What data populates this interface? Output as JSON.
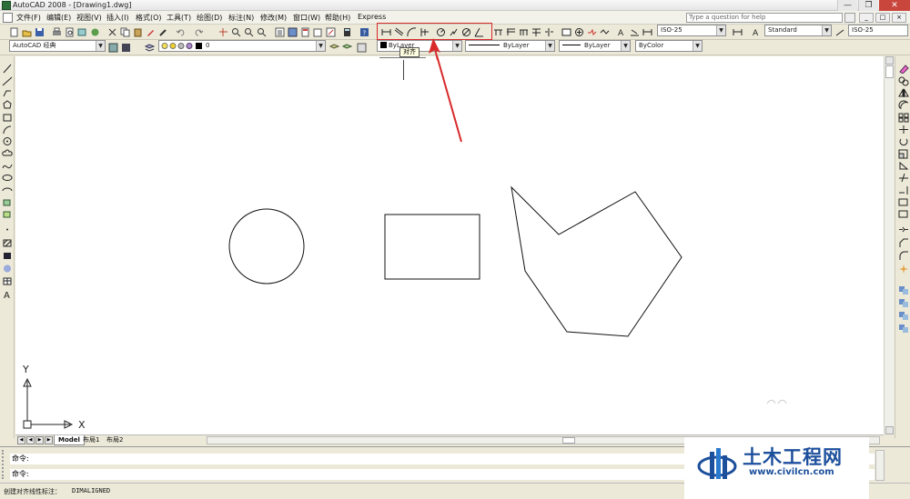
{
  "window": {
    "title": "AutoCAD 2008 - [Drawing1.dwg]",
    "minimize_glyph": "—",
    "restore_glyph": "❐",
    "close_glyph": "✕"
  },
  "menu": {
    "items": [
      "文件(F)",
      "编辑(E)",
      "视图(V)",
      "插入(I)",
      "格式(O)",
      "工具(T)",
      "绘图(D)",
      "标注(N)",
      "修改(M)",
      "窗口(W)",
      "帮助(H)",
      "Express"
    ],
    "help_search_placeholder": "Type a question for help",
    "mdi_min": "_",
    "mdi_restore": "□",
    "mdi_close": "×"
  },
  "toolbar1": {
    "dimstyle": "ISO-25",
    "textstyle": "Standard",
    "tablestyle": "ISO-25"
  },
  "toolbar2": {
    "workspace": "AutoCAD 经典",
    "layer": "0",
    "color": "ByLayer",
    "linetype": "ByLayer",
    "lineweight": "ByLayer",
    "plotstyle": "ByColor"
  },
  "tooltip": {
    "text": "对齐"
  },
  "ucs": {
    "x_label": "X",
    "y_label": "Y"
  },
  "tabs": {
    "model": "Model",
    "layout1": "布局1",
    "layout2": "布局2"
  },
  "command": {
    "line1": "命令:",
    "line2": "命令:"
  },
  "status": {
    "text": "创建对齐线性标注：",
    "command": "DIMALIGNED"
  },
  "watermark": {
    "name": "土木工程网",
    "url": "www.civilcn.com"
  },
  "colors": {
    "highlight": "#d82a2a",
    "arrow": "#d82a2a",
    "watermark_blue": "#1c4f9c"
  }
}
